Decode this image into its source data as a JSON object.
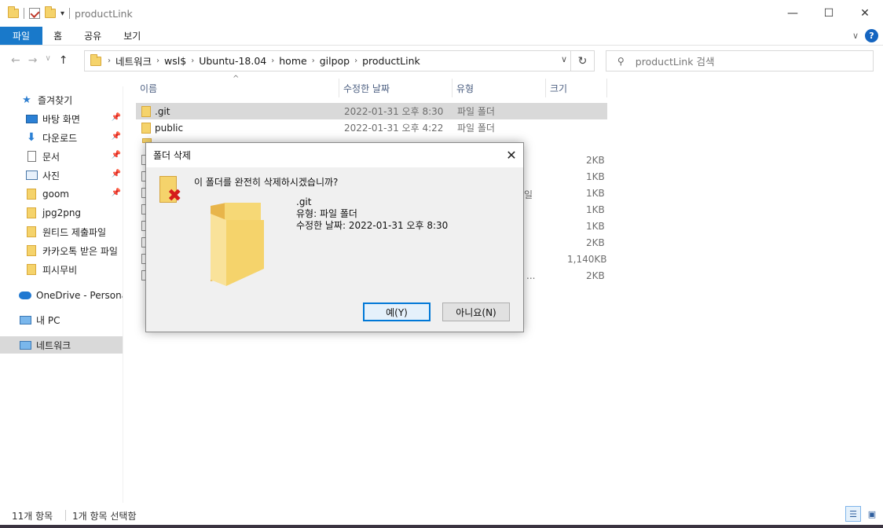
{
  "window": {
    "title": "productLink",
    "minimize": "—",
    "maximize": "☐",
    "close": "✕"
  },
  "ribbon": {
    "tabs": [
      "파일",
      "홈",
      "공유",
      "보기"
    ],
    "help": "?",
    "collapse": "∨"
  },
  "address": {
    "crumbs": [
      "네트워크",
      "wsl$",
      "Ubuntu-18.04",
      "home",
      "gilpop",
      "productLink"
    ],
    "search_placeholder": "productLink 검색"
  },
  "sidebar": {
    "items": [
      {
        "label": "즐겨찾기",
        "icon": "star-icon"
      },
      {
        "label": "바탕 화면",
        "icon": "desktop-icon",
        "pinned": true
      },
      {
        "label": "다운로드",
        "icon": "download-icon",
        "pinned": true
      },
      {
        "label": "문서",
        "icon": "document-icon",
        "pinned": true
      },
      {
        "label": "사진",
        "icon": "pictures-icon",
        "pinned": true
      },
      {
        "label": "goom",
        "icon": "folder-icon",
        "pinned": true
      },
      {
        "label": "jpg2png",
        "icon": "folder-icon"
      },
      {
        "label": "원티드 제출파일",
        "icon": "folder-icon"
      },
      {
        "label": "카카오톡 받은 파일",
        "icon": "folder-icon"
      },
      {
        "label": "피시무비",
        "icon": "folder-icon"
      },
      {
        "label": "OneDrive - Personal",
        "icon": "onedrive-icon"
      },
      {
        "label": "내 PC",
        "icon": "pc-icon"
      },
      {
        "label": "네트워크",
        "icon": "network-icon",
        "selected": true
      }
    ]
  },
  "file_list": {
    "columns": [
      "이름",
      "수정한 날짜",
      "유형",
      "크기"
    ],
    "rows": [
      {
        "name": ".git",
        "date": "2022-01-31 오후 8:30",
        "type": "파일 폴더",
        "size": "",
        "selected": true
      },
      {
        "name": "public",
        "date": "2022-01-31 오후 4:22",
        "type": "파일 폴더",
        "size": ""
      }
    ],
    "hidden_sizes": [
      "2KB",
      "1KB",
      "1KB",
      "1KB",
      "1KB",
      "2KB",
      "1,140KB",
      "2KB"
    ],
    "partial_type_glyph": "일",
    "partial_ellipsis": "..."
  },
  "status": {
    "count": "11개 항목",
    "selected": "1개 항목 선택함"
  },
  "dialog": {
    "title": "폴더 삭제",
    "question": "이 폴더를 완전히 삭제하시겠습니까?",
    "item_name": ".git",
    "item_type": "유형: 파일 폴더",
    "item_date": "수정한 날짜: 2022-01-31 오후 8:30",
    "yes": "예(Y)",
    "no": "아니요(N)",
    "close": "✕"
  },
  "colors": {
    "accent": "#1979ca",
    "folder": "#f5d36b",
    "delete_x": "#d51b1b"
  }
}
